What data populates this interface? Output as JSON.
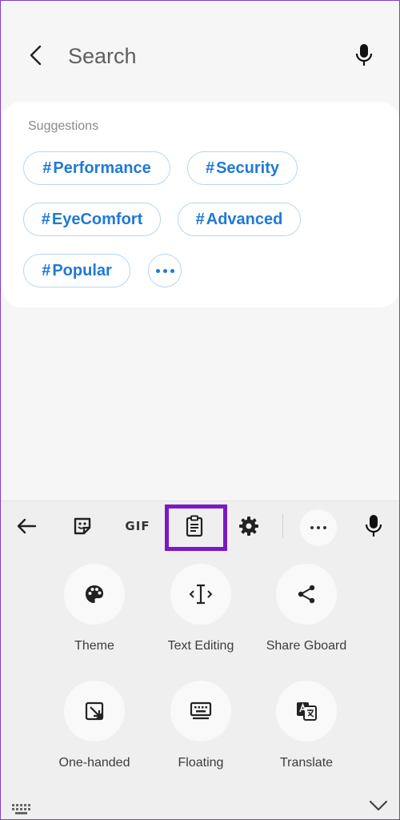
{
  "header": {
    "search_placeholder": "Search",
    "icons": {
      "back": "back-arrow-icon",
      "mic": "microphone-icon"
    }
  },
  "suggestions": {
    "title": "Suggestions",
    "chips": [
      {
        "hash": "#",
        "label": "Performance"
      },
      {
        "hash": "#",
        "label": "Security"
      },
      {
        "hash": "#",
        "label": "EyeComfort"
      },
      {
        "hash": "#",
        "label": "Advanced"
      },
      {
        "hash": "#",
        "label": "Popular"
      }
    ],
    "more_icon": "more-horizontal-icon"
  },
  "keyboard": {
    "toolbar": {
      "gif_label": "GIF",
      "items": [
        "back-arrow-icon",
        "sticker-icon",
        "gif-icon",
        "clipboard-icon",
        "settings-icon",
        "more-icon",
        "microphone-icon"
      ],
      "highlighted": "clipboard-icon",
      "highlight_color": "#7a18c8"
    },
    "tiles": [
      {
        "label": "Theme",
        "icon": "palette-icon"
      },
      {
        "label": "Text Editing",
        "icon": "text-cursor-icon"
      },
      {
        "label": "Share Gboard",
        "icon": "share-icon"
      },
      {
        "label": "One-handed",
        "icon": "one-handed-icon"
      },
      {
        "label": "Floating",
        "icon": "floating-keyboard-icon"
      },
      {
        "label": "Translate",
        "icon": "translate-icon"
      }
    ],
    "bottom_icons": [
      "keyboard-icon",
      "chevron-down-icon"
    ]
  },
  "colors": {
    "accent": "#1f7ad6",
    "chip_border": "#b9d6ee",
    "background": "#f6f6f6"
  }
}
